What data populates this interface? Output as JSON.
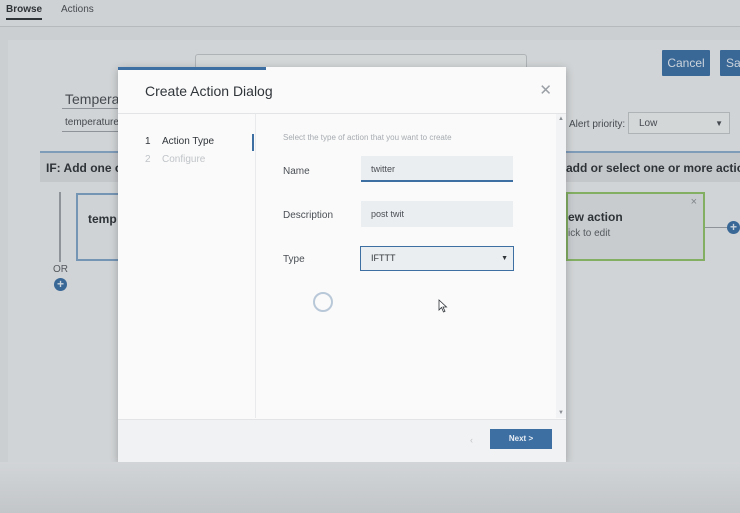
{
  "topnav": {
    "tabs": [
      {
        "label": "Browse"
      },
      {
        "label": "Actions"
      }
    ]
  },
  "page": {
    "cancel_label": "Cancel",
    "save_label": "Sa",
    "rule_name": "Temperat",
    "rule_select_value": "temperature",
    "alert_priority_label": "Alert priority:",
    "alert_priority_value": "Low",
    "if_text": "IF: Add one o",
    "then_text": "add or select one or more actions.",
    "or_label": "OR",
    "condition_card_text": "temp",
    "action_card_title": "ew action",
    "action_card_subtitle": "ick to edit"
  },
  "dialog": {
    "title": "Create Action Dialog",
    "steps": [
      {
        "num": "1",
        "label": "Action Type"
      },
      {
        "num": "2",
        "label": "Configure"
      }
    ],
    "hint": "Select the type of action that you want to create",
    "fields": {
      "name_label": "Name",
      "name_value": "twitter",
      "description_label": "Description",
      "description_value": "post twit",
      "type_label": "Type",
      "type_value": "IFTTT"
    },
    "back_label": "‹",
    "next_label": "Next >"
  },
  "icons": {
    "close": "close-icon",
    "dropdown": "chevron-down-icon",
    "plus": "plus-icon",
    "spinner": "loading-spinner-icon",
    "cursor": "mouse-pointer-icon"
  },
  "colors": {
    "primary": "#3d6fa3",
    "action_card_border": "#8fbf6a"
  }
}
